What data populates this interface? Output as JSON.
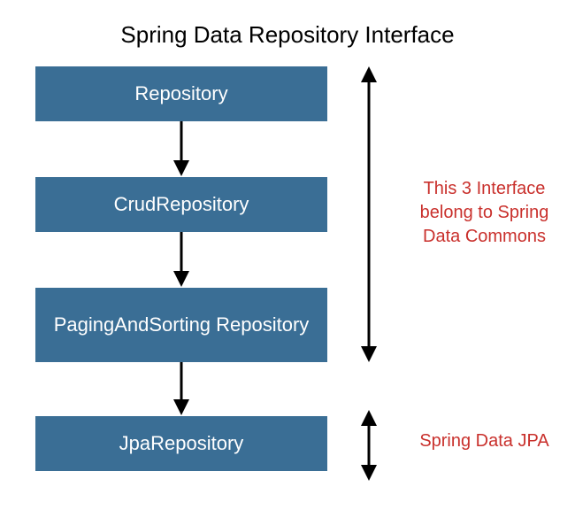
{
  "title": "Spring Data Repository Interface",
  "boxes": {
    "b1": "Repository",
    "b2": "CrudRepository",
    "b3": "PagingAndSorting Repository",
    "b4": "JpaRepository"
  },
  "annotations": {
    "group1": "This 3 Interface belong to Spring Data Commons",
    "group2": "Spring Data JPA"
  },
  "colors": {
    "box_bg": "#3a6e95",
    "annotation_text": "#c9302c"
  }
}
